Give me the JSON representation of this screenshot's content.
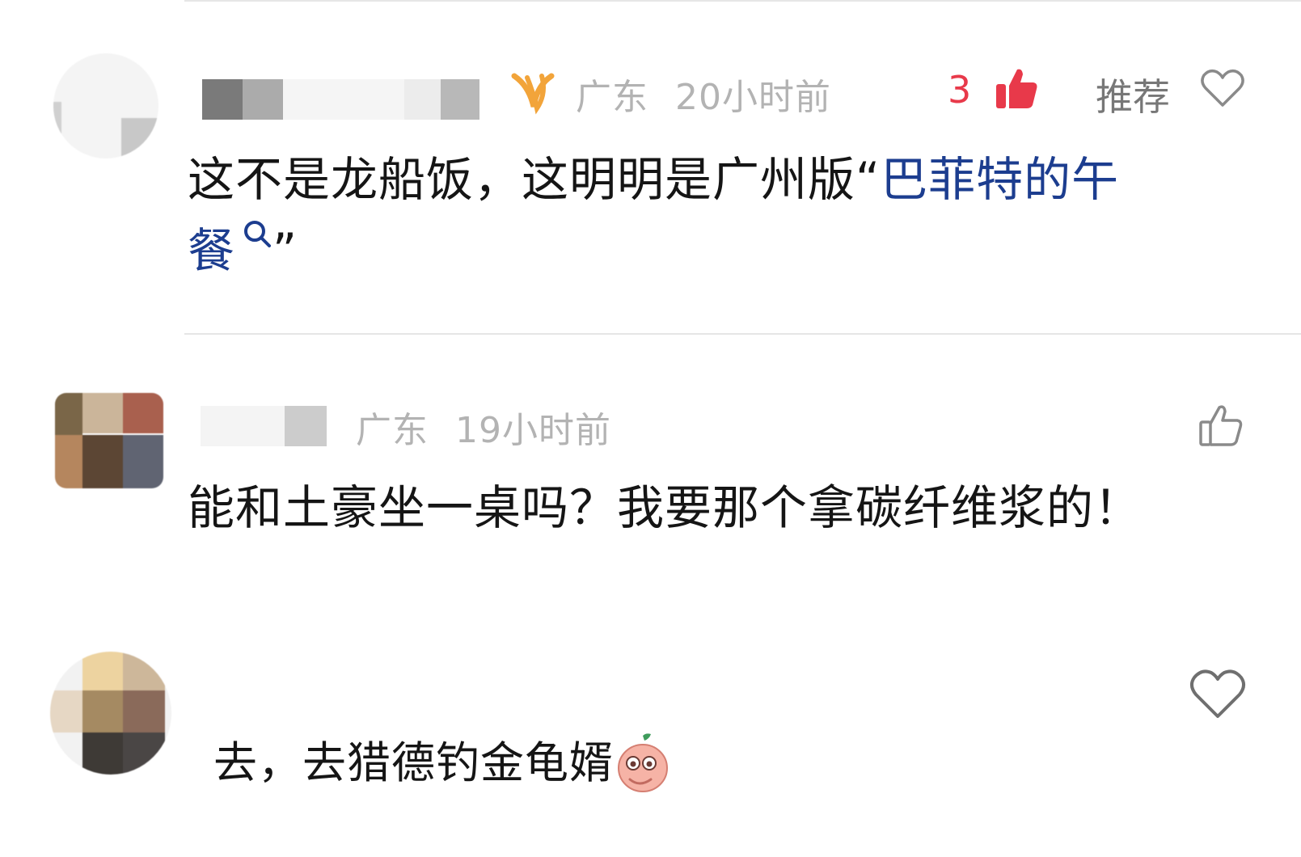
{
  "colors": {
    "liked_red": "#e8394a",
    "link_blue": "#1c3d8f",
    "meta_gray": "#b3b3b3",
    "badge_orange": "#f2a43a"
  },
  "comments": [
    {
      "location": "广东",
      "time": "20小时前",
      "like_count": "3",
      "recommend_label": "推荐",
      "text_prefix": "这不是龙船饭，这明明是广州版“",
      "text_link_line1": "巴菲特的午",
      "text_link_line2": "餐",
      "text_suffix": "”",
      "icons": [
        "user-badge-icon",
        "thumbs-up-filled-icon",
        "heart-outline-icon",
        "search-icon"
      ]
    },
    {
      "location": "广东",
      "time": "19小时前",
      "text": "能和土豪坐一桌吗？我要那个拿碳纤维浆的！",
      "icons": [
        "thumbs-up-outline-icon"
      ]
    },
    {
      "text": "去，去猎德钓金龟婿",
      "icons": [
        "peach-emoji-icon",
        "heart-outline-icon"
      ]
    }
  ]
}
